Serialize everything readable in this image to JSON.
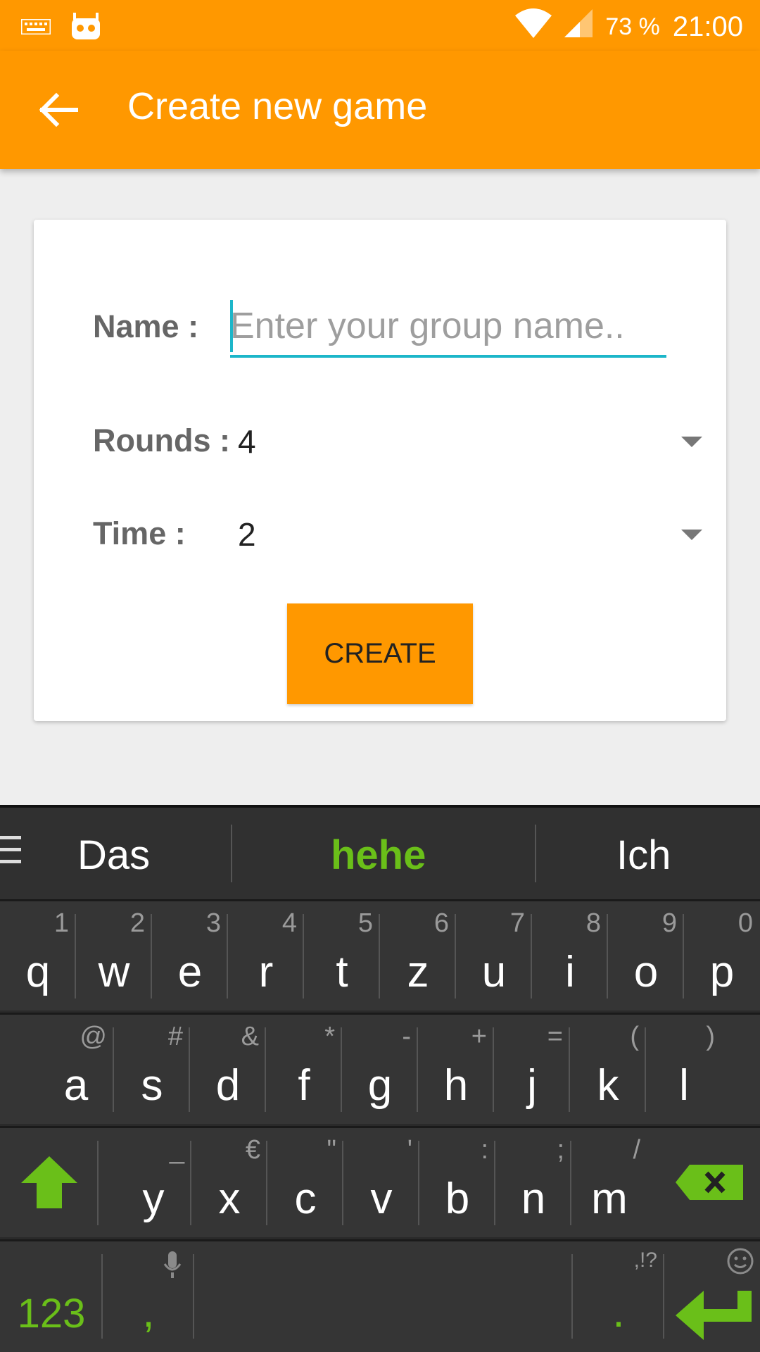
{
  "status": {
    "battery": "73 %",
    "time": "21:00"
  },
  "appbar": {
    "title": "Create new game"
  },
  "form": {
    "name_label": "Name :",
    "name_placeholder": "Enter your group name..",
    "rounds_label": "Rounds :",
    "rounds_value": "4",
    "time_label": "Time :",
    "time_value": "2",
    "create_label": "CREATE"
  },
  "keyboard": {
    "suggestions": [
      "Das",
      "hehe",
      "Ich"
    ],
    "row1": [
      {
        "k": "q",
        "a": "1"
      },
      {
        "k": "w",
        "a": "2"
      },
      {
        "k": "e",
        "a": "3"
      },
      {
        "k": "r",
        "a": "4"
      },
      {
        "k": "t",
        "a": "5"
      },
      {
        "k": "z",
        "a": "6"
      },
      {
        "k": "u",
        "a": "7"
      },
      {
        "k": "i",
        "a": "8"
      },
      {
        "k": "o",
        "a": "9"
      },
      {
        "k": "p",
        "a": "0"
      }
    ],
    "row2": [
      {
        "k": "a",
        "a": "@"
      },
      {
        "k": "s",
        "a": "#"
      },
      {
        "k": "d",
        "a": "&"
      },
      {
        "k": "f",
        "a": "*"
      },
      {
        "k": "g",
        "a": "-"
      },
      {
        "k": "h",
        "a": "+"
      },
      {
        "k": "j",
        "a": "="
      },
      {
        "k": "k",
        "a": "("
      },
      {
        "k": "l",
        "a": ")"
      }
    ],
    "row3": [
      {
        "k": "y",
        "a": "_"
      },
      {
        "k": "x",
        "a": "€"
      },
      {
        "k": "c",
        "a": "\""
      },
      {
        "k": "v",
        "a": "'"
      },
      {
        "k": "b",
        "a": ":"
      },
      {
        "k": "n",
        "a": ";"
      },
      {
        "k": "m",
        "a": "/"
      }
    ],
    "bottom": {
      "num": "123",
      "comma": ",",
      "period": ".",
      "period_alt": ",!?"
    }
  },
  "colors": {
    "accent": "#ff9800",
    "input_line": "#1cb6c9",
    "key_green": "#6abf19"
  }
}
